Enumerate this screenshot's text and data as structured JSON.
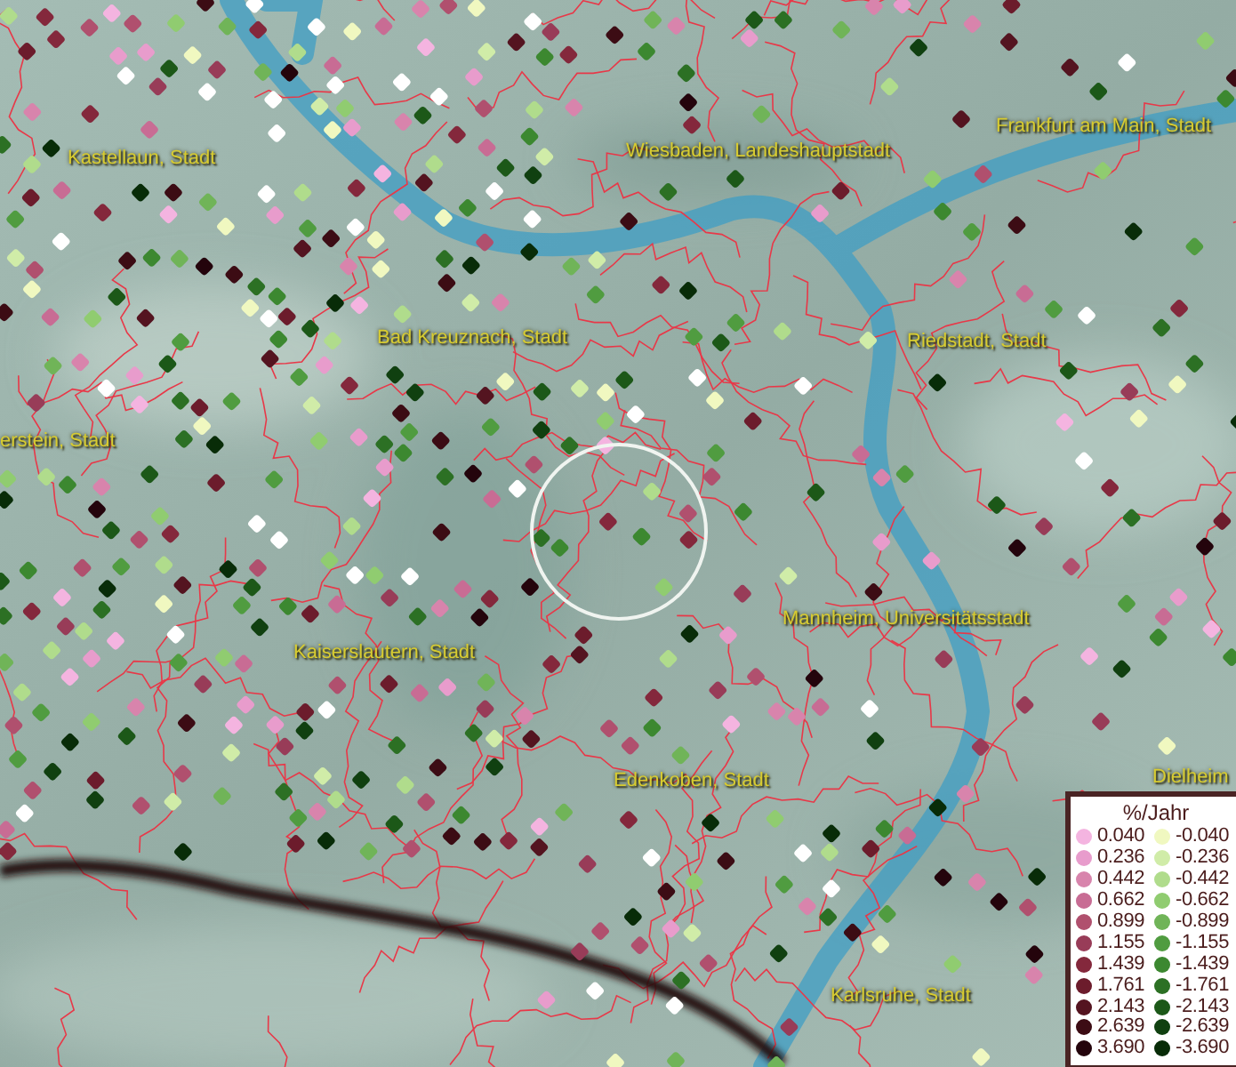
{
  "map": {
    "place_labels": [
      "Kastellaun, Stadt",
      "Wiesbaden, Landeshauptstadt",
      "Frankfurt am Main, Stadt",
      "Bad Kreuznach, Stadt",
      "Riedstadt, Stadt",
      "erstein, Stadt",
      "Kaiserslautern, Stadt",
      "Mannheim, Universitätsstadt",
      "Edenkoben, Stadt",
      "Dielheim",
      "Karlsruhe, Stadt"
    ]
  },
  "legend": {
    "title": "%/Jahr",
    "rows": [
      {
        "positive": {
          "value": "0.040",
          "color": "#f4b4e0"
        },
        "negative": {
          "value": "-0.040",
          "color": "#f0f8c0"
        }
      },
      {
        "positive": {
          "value": "0.236",
          "color": "#e89ccc"
        },
        "negative": {
          "value": "-0.236",
          "color": "#d0eca8"
        }
      },
      {
        "positive": {
          "value": "0.442",
          "color": "#d884ac"
        },
        "negative": {
          "value": "-0.442",
          "color": "#b0dc8c"
        }
      },
      {
        "positive": {
          "value": "0.662",
          "color": "#c86c94"
        },
        "negative": {
          "value": "-0.662",
          "color": "#90cc70"
        }
      },
      {
        "positive": {
          "value": "0.899",
          "color": "#b0506e"
        },
        "negative": {
          "value": "-0.899",
          "color": "#70b458"
        }
      },
      {
        "positive": {
          "value": "1.155",
          "color": "#983c58"
        },
        "negative": {
          "value": "-1.155",
          "color": "#509c40"
        }
      },
      {
        "positive": {
          "value": "1.439",
          "color": "#84283c"
        },
        "negative": {
          "value": "-1.439",
          "color": "#3c8830"
        }
      },
      {
        "positive": {
          "value": "1.761",
          "color": "#6c1c2c"
        },
        "negative": {
          "value": "-1.761",
          "color": "#2c7024"
        }
      },
      {
        "positive": {
          "value": "2.143",
          "color": "#541420"
        },
        "negative": {
          "value": "-2.143",
          "color": "#1c5818"
        }
      },
      {
        "positive": {
          "value": "2.639",
          "color": "#3c0c14"
        },
        "negative": {
          "value": "-2.639",
          "color": "#104010"
        }
      },
      {
        "positive": {
          "value": "3.690",
          "color": "#24040c"
        },
        "negative": {
          "value": "-3.690",
          "color": "#082c08"
        }
      }
    ]
  }
}
